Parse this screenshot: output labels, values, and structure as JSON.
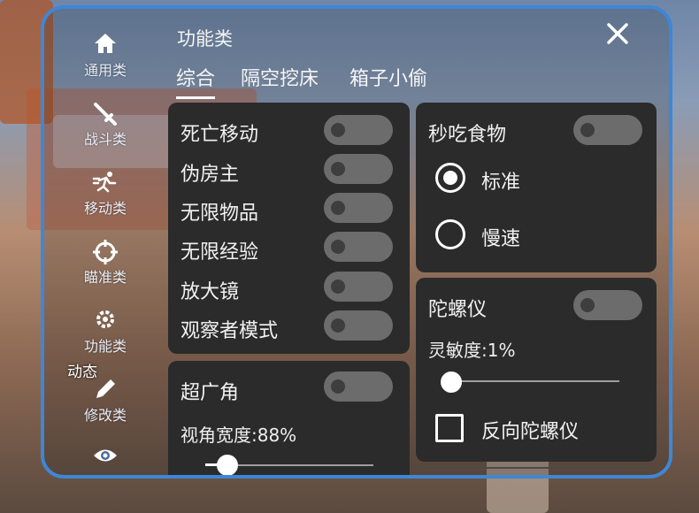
{
  "panel": {
    "title": "功能类",
    "close_icon": "close-icon"
  },
  "sidebar": {
    "items": [
      {
        "label": "通用类",
        "icon": "home-icon"
      },
      {
        "label": "战斗类",
        "icon": "sword-icon"
      },
      {
        "label": "移动类",
        "icon": "running-icon"
      },
      {
        "label": "瞄准类",
        "icon": "crosshair-icon"
      },
      {
        "label": "功能类",
        "icon": "gear-icon"
      },
      {
        "label": "修改类",
        "icon": "pencil-icon"
      },
      {
        "label": "",
        "icon": "eye-icon"
      }
    ],
    "overlay_label": "动态"
  },
  "tabs": [
    {
      "label": "综合",
      "active": true
    },
    {
      "label": "隔空挖床",
      "active": false
    },
    {
      "label": "箱子小偷",
      "active": false
    }
  ],
  "general": {
    "toggles": [
      {
        "label": "死亡移动",
        "on": false
      },
      {
        "label": "伪房主",
        "on": false
      },
      {
        "label": "无限物品",
        "on": false
      },
      {
        "label": "无限经验",
        "on": false
      },
      {
        "label": "放大镜",
        "on": false
      },
      {
        "label": "观察者模式",
        "on": false
      }
    ]
  },
  "fov": {
    "label": "超广角",
    "on": false,
    "value_label": "视角宽度:88%",
    "value_percent": 88
  },
  "instant_eat": {
    "label": "秒吃食物",
    "on": false,
    "options": [
      {
        "label": "标准",
        "selected": true
      },
      {
        "label": "慢速",
        "selected": false
      }
    ]
  },
  "gyroscope": {
    "label": "陀螺仪",
    "on": false,
    "sensitivity_label": "灵敏度:1%",
    "sensitivity_percent": 1,
    "invert_label": "反向陀螺仪",
    "invert_checked": false
  },
  "colors": {
    "panel_border": "#3e87d6",
    "card_bg": "#2b2b2b",
    "toggle_off": "#6c6c6c"
  }
}
